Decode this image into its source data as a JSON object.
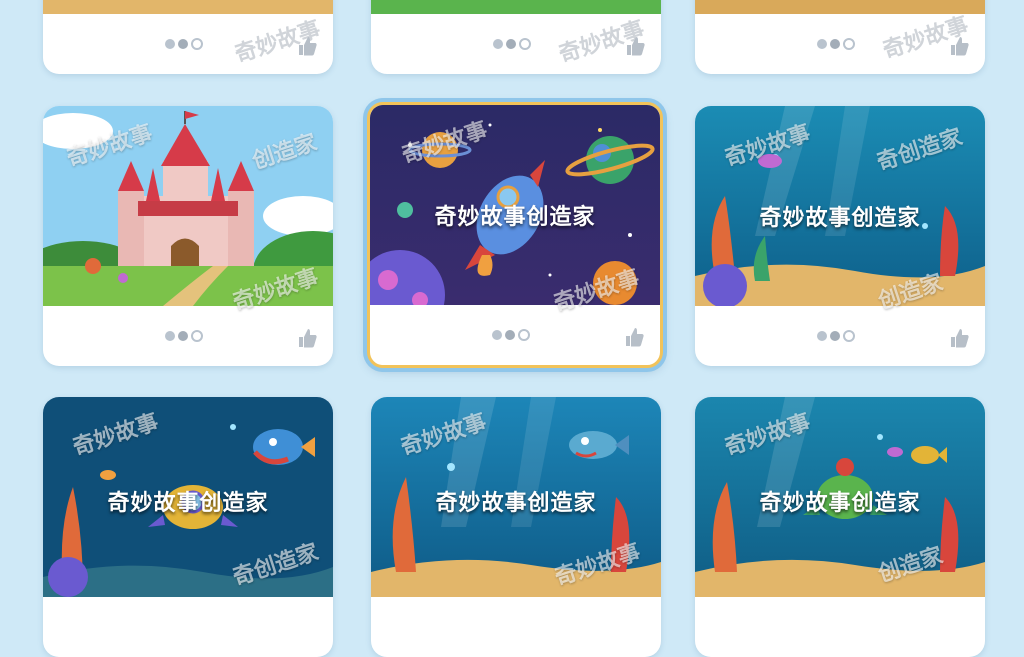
{
  "watermark": "奇妙故事",
  "watermark_alt": "创造家",
  "watermark_mix": "奇创造家",
  "card_title": "奇妙故事创造家",
  "colors": {
    "background": "#cfe9f7",
    "selected_border": "#f2c35a",
    "selected_glow": "#8fc6ea"
  },
  "cards": [
    {
      "scene": "castle-top",
      "footer_icons": [
        "dot",
        "dot",
        "ring-dot"
      ],
      "action_icon": "thumbs-up-icon"
    },
    {
      "scene": "meadow-top",
      "footer_icons": [
        "dot",
        "dot",
        "ring-dot"
      ],
      "action_icon": "thumbs-up-icon"
    },
    {
      "scene": "sand-top",
      "footer_icons": [
        "dot",
        "dot",
        "ring-dot"
      ],
      "action_icon": "thumbs-up-icon"
    },
    {
      "scene": "castle",
      "selected": false
    },
    {
      "scene": "space-rocket",
      "selected": true
    },
    {
      "scene": "ocean",
      "selected": false
    },
    {
      "scene": "submarine-fish",
      "selected": false
    },
    {
      "scene": "ocean-fish",
      "selected": false
    },
    {
      "scene": "ocean-turtle",
      "selected": false
    }
  ]
}
